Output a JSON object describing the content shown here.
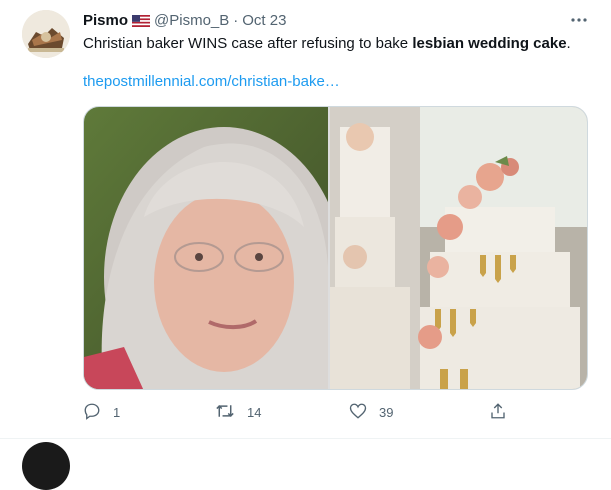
{
  "tweet": {
    "author": {
      "display_name": "Pismo",
      "handle": "@Pismo_B",
      "separator": "·",
      "date": "Oct 23",
      "flag_icon": "us-flag-icon"
    },
    "text_normal": "Christian baker WINS case after refusing to bake ",
    "text_bold": "lesbian wedding cake",
    "text_end": ".",
    "link_text": "thepostmillennial.com/christian-bake…",
    "media": {
      "left_image": "woman-portrait-image",
      "right_image": "wedding-cake-image"
    },
    "actions": {
      "reply_count": "1",
      "retweet_count": "14",
      "like_count": "39",
      "share_label": ""
    }
  },
  "colors": {
    "accent": "#1d9bf0",
    "secondary_text": "#536471",
    "border": "#cfd9de"
  }
}
